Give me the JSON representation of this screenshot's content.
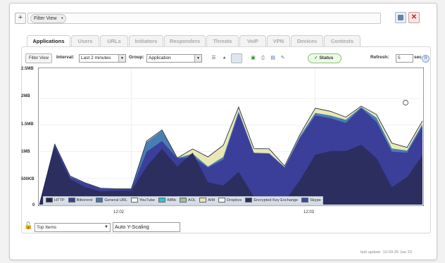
{
  "filter_bar": {
    "add_label": "+",
    "chip_label": "Filter View",
    "chip_marker": "•",
    "close_label": "✕"
  },
  "tabs": [
    {
      "label": "Applications",
      "active": true
    },
    {
      "label": "Users"
    },
    {
      "label": "URLs"
    },
    {
      "label": "Initiators"
    },
    {
      "label": "Responders"
    },
    {
      "label": "Threats"
    },
    {
      "label": "VoIP"
    },
    {
      "label": "VPN"
    },
    {
      "label": "Devices"
    },
    {
      "label": "Contests"
    }
  ],
  "toolbar": {
    "filter_view": "Filter View",
    "interval_label": "Interval:",
    "interval_value": "Last 2 minutes",
    "group_label": "Group:",
    "group_value": "Application",
    "status_label": "Status",
    "refresh_label": "Refresh:",
    "refresh_value": "5",
    "refresh_unit": "sec."
  },
  "chart_data": {
    "type": "area",
    "y_ticks": [
      "2.5MB",
      "2MB",
      "1.5MB",
      "1MB",
      "500KB",
      "0"
    ],
    "ylim_kb": [
      0,
      2560
    ],
    "x_tick_labels": [
      "12:02",
      "12:03"
    ],
    "legend": [
      {
        "name": "HTTP",
        "color": "#1f2a4e"
      },
      {
        "name": "Bittorrent",
        "color": "#3b3f9a"
      },
      {
        "name": "General URL",
        "color": "#3f78b2"
      },
      {
        "name": "YouTube",
        "color": "#fbfbf0"
      },
      {
        "name": "IMBb",
        "color": "#2ec4d4"
      },
      {
        "name": "AOL",
        "color": "#9fbf9a"
      },
      {
        "name": "AIM",
        "color": "#e8e6b0"
      },
      {
        "name": "Dropbox",
        "color": "#f7f7f7"
      },
      {
        "name": "Encrypted Key Exchange",
        "color": "#2b2e5f"
      },
      {
        "name": "Skype",
        "color": "#3a4aa0"
      }
    ],
    "series_total_kb": [
      0,
      1140,
      540,
      410,
      310,
      300,
      300,
      1200,
      1410,
      880,
      1050,
      900,
      1120,
      1840,
      1060,
      1050,
      730,
      1320,
      1820,
      1760,
      1650,
      1860,
      1700,
      1160,
      1080,
      1580
    ],
    "layers": [
      {
        "name": "Encrypted Key Exchange",
        "values_kb": [
          0,
          1080,
          480,
          330,
          250,
          260,
          260,
          720,
          1050,
          720,
          980,
          420,
          360,
          620,
          150,
          60,
          60,
          460,
          940,
          1010,
          1010,
          1130,
          880,
          330,
          520,
          930
        ]
      },
      {
        "name": "Bittorrent",
        "values_kb": [
          0,
          1120,
          520,
          400,
          300,
          290,
          290,
          1000,
          1200,
          870,
          900,
          700,
          850,
          1720,
          970,
          960,
          700,
          1250,
          1680,
          1630,
          1540,
          1820,
          1560,
          1000,
          980,
          1480
        ]
      },
      {
        "name": "General URL",
        "values_kb": [
          0,
          1130,
          530,
          405,
          305,
          295,
          295,
          1180,
          1400,
          880,
          960,
          720,
          900,
          1760,
          980,
          970,
          710,
          1290,
          1730,
          1680,
          1600,
          1840,
          1640,
          1060,
          1020,
          1520
        ]
      },
      {
        "name": "AIM",
        "values_kb": [
          0,
          1140,
          540,
          410,
          310,
          300,
          300,
          1200,
          1410,
          880,
          1050,
          900,
          1120,
          1840,
          1060,
          1050,
          730,
          1320,
          1820,
          1760,
          1650,
          1860,
          1700,
          1160,
          1080,
          1580
        ]
      }
    ]
  },
  "bottom": {
    "top_items": "Top Items",
    "auto_scale": "Auto Y-Scaling"
  },
  "last_update": "last update: 12:03:25 Jun 22"
}
